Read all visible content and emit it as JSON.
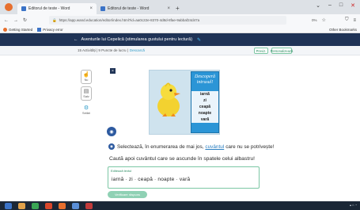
{
  "browser": {
    "tabs": [
      {
        "title": "Editorul de teste - Word",
        "active": true
      },
      {
        "title": "Editorul de teste - Word",
        "active": false
      }
    ],
    "new_tab": "+",
    "url": "https://app.wand.education/editor/index.html?id=aa0c22e-8370-4d8d-8fae-9abbaf24d47a",
    "zoom": "0%",
    "bookmarks": [
      "Getting Started",
      "Privacy error"
    ],
    "other_bookmarks": "Other Bookmarks"
  },
  "header": {
    "title": "Aventurile lui Cepelică (stimularea gustului pentru lectură)"
  },
  "subheader": {
    "text": "15 Activități | 9 Puncte de lucru |",
    "link": "Descarcă",
    "btn_preview": "Previz.",
    "btn_personalize": "Personalizează"
  },
  "tools": [
    {
      "icon": "hand-icon",
      "label": "Nu"
    },
    {
      "icon": "save-icon",
      "label": "Salv"
    },
    {
      "icon": "gear-icon",
      "label": "Setări"
    }
  ],
  "card": {
    "title_line1": "Descoperă",
    "title_line2": "intrusul!",
    "words": [
      "iarnă",
      "zi",
      "ceapă",
      "noapte",
      "vară"
    ]
  },
  "instruction": {
    "before": "Selectează, în enumerarea de mai jos,",
    "keyword": "cuvântul",
    "after": "care nu se potrivește!"
  },
  "question": "Caută apoi cuvântul care se ascunde în spatele celui albastru!",
  "answer": {
    "label": "Editează textul",
    "value": "iarnă · zi · ceapă · noapte · vară"
  },
  "check_button": "Verificare răspuns",
  "colors": {
    "header": "#1f3356",
    "panel": "#2b95d6",
    "accent_green": "#7cc7a4"
  }
}
